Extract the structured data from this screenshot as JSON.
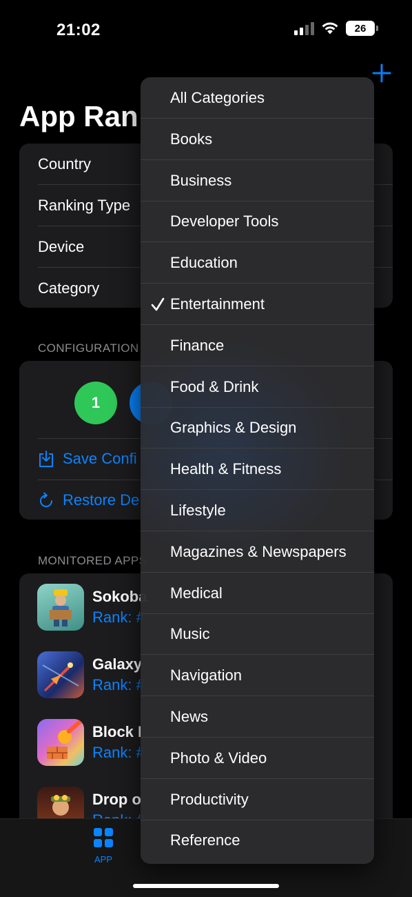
{
  "status_bar": {
    "time": "21:02",
    "battery": "26"
  },
  "header": {
    "title": "App Ran"
  },
  "filters": {
    "rows": [
      {
        "label": "Country"
      },
      {
        "label": "Ranking Type"
      },
      {
        "label": "Device"
      },
      {
        "label": "Category"
      }
    ]
  },
  "configuration": {
    "header": "CONFIGURATION",
    "slots": [
      "1",
      ""
    ],
    "save_label": "Save Confi",
    "restore_label": "Restore De"
  },
  "monitored_apps": {
    "header": "MONITORED APPS",
    "items": [
      {
        "name": "Sokoba",
        "rank": "Rank: #"
      },
      {
        "name": "Galaxy",
        "rank": "Rank: #"
      },
      {
        "name": "Block I",
        "rank": "Rank: #"
      },
      {
        "name": "Drop o",
        "rank": "Rank: #"
      }
    ]
  },
  "tab_bar": {
    "app_label": "APP"
  },
  "category_menu": {
    "selected": "Entertainment",
    "items": [
      "All Categories",
      "Books",
      "Business",
      "Developer Tools",
      "Education",
      "Entertainment",
      "Finance",
      "Food & Drink",
      "Graphics & Design",
      "Health & Fitness",
      "Lifestyle",
      "Magazines & Newspapers",
      "Medical",
      "Music",
      "Navigation",
      "News",
      "Photo & Video",
      "Productivity",
      "Reference"
    ]
  },
  "colors": {
    "accent": "#0a84ff",
    "green": "#30c759",
    "card": "#1c1c1e",
    "menu": "#2c2c2e"
  }
}
